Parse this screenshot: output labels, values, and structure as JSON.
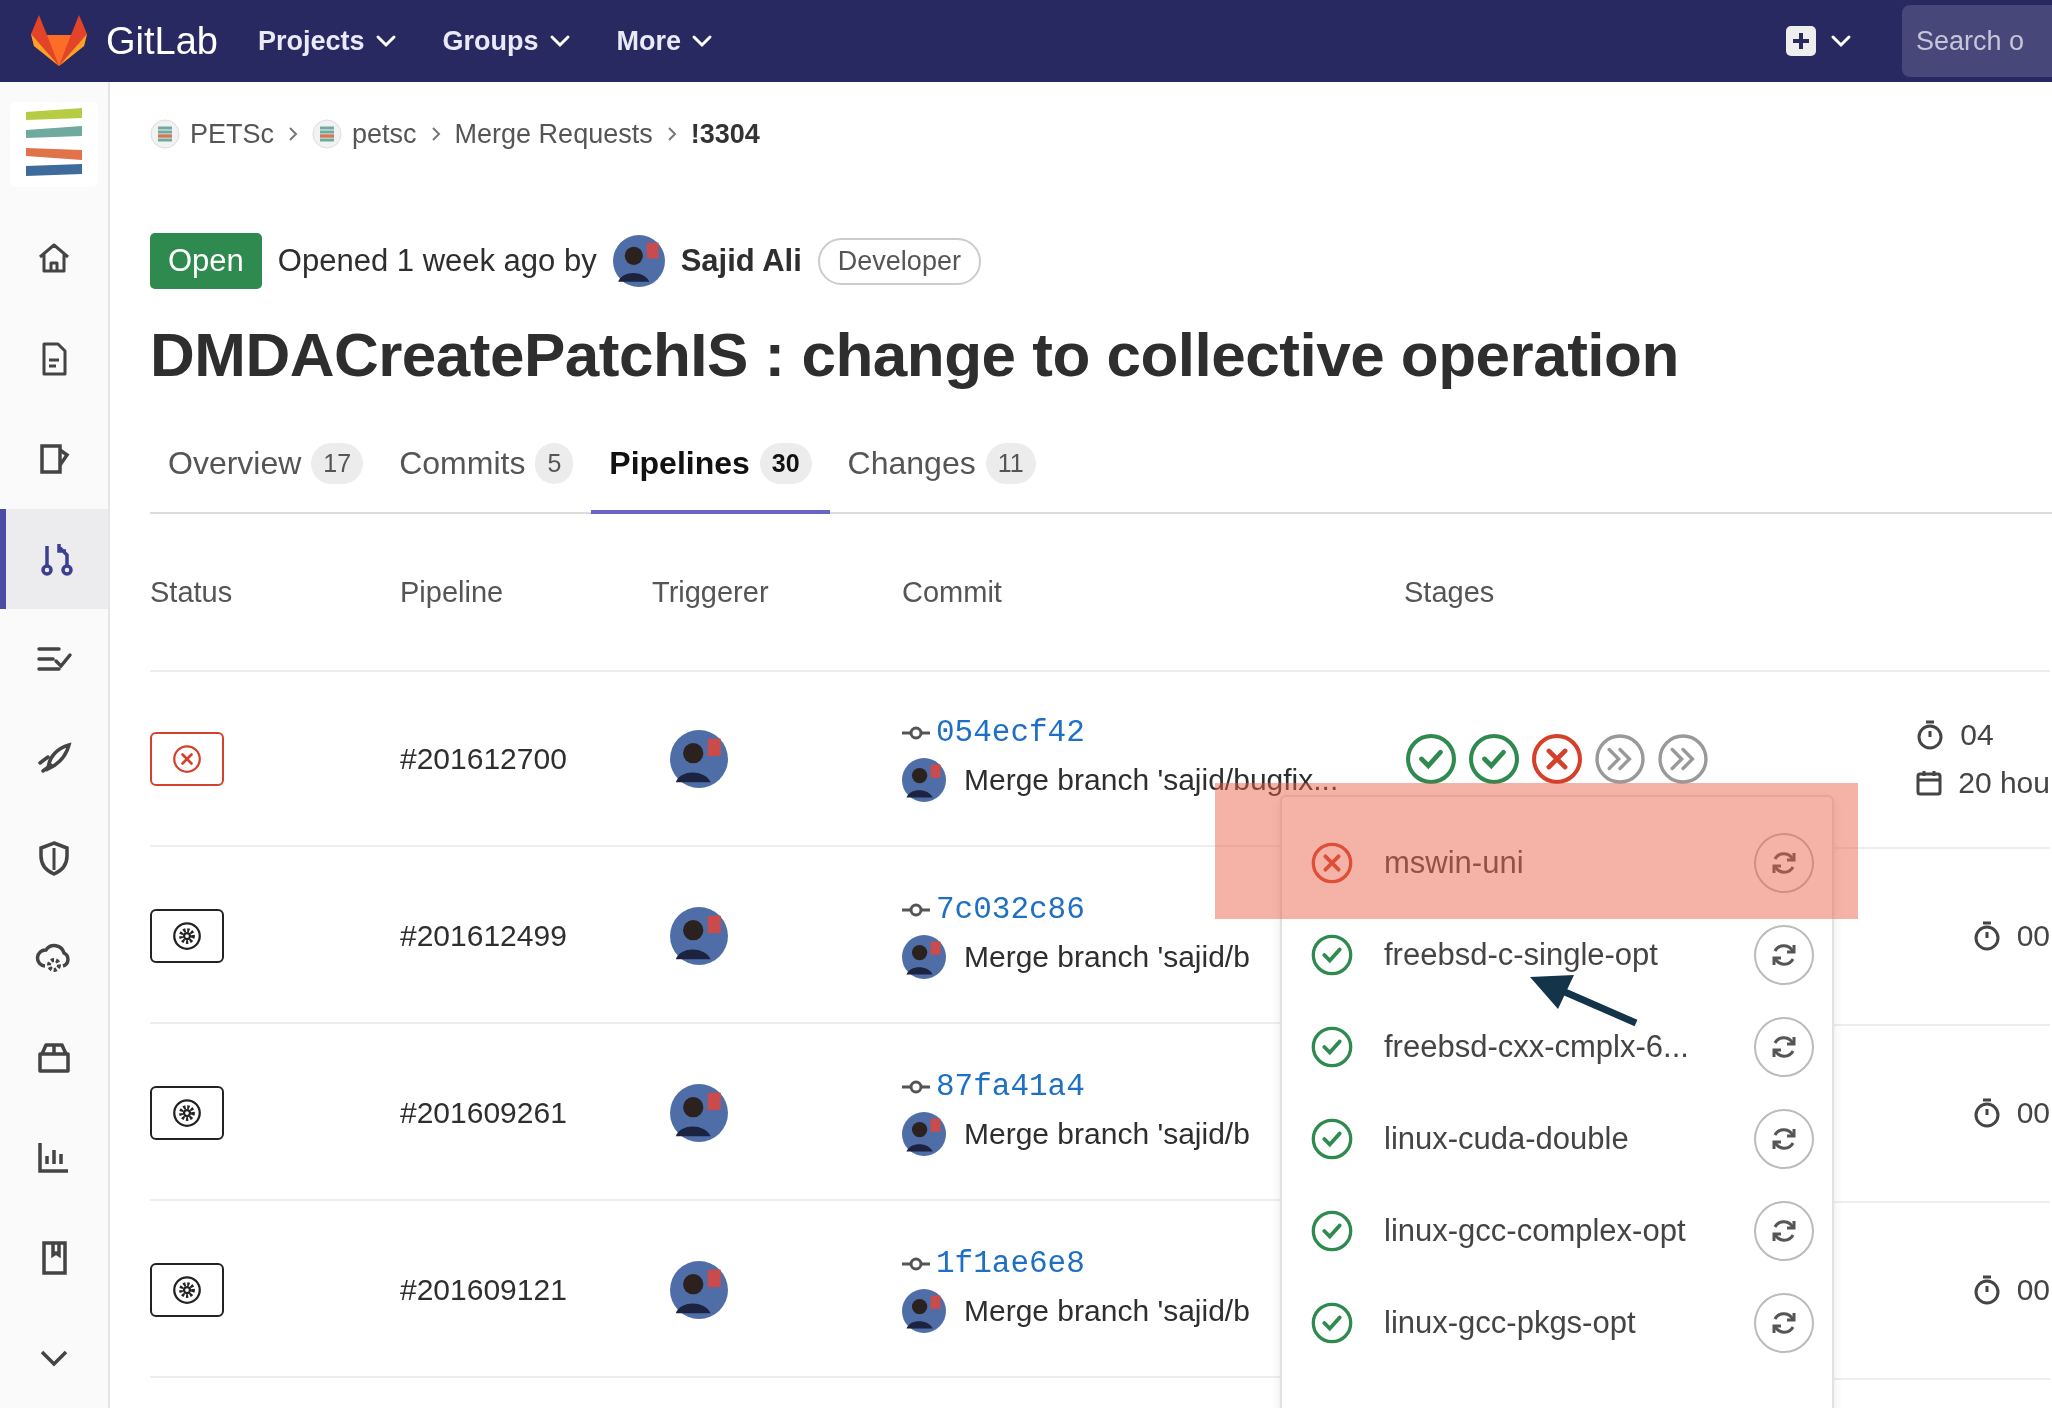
{
  "topbar": {
    "brand": "GitLab",
    "nav": [
      "Projects",
      "Groups",
      "More"
    ],
    "search": {
      "placeholder": "Search o"
    }
  },
  "sidebar": {
    "items": [
      {
        "kind": "home",
        "selected": false
      },
      {
        "kind": "doc",
        "selected": false
      },
      {
        "kind": "issue",
        "selected": false
      },
      {
        "kind": "merge",
        "selected": true
      },
      {
        "kind": "list",
        "selected": false
      },
      {
        "kind": "rocket",
        "selected": false
      },
      {
        "kind": "shield",
        "selected": false
      },
      {
        "kind": "cloud",
        "selected": false
      },
      {
        "kind": "package",
        "selected": false
      },
      {
        "kind": "chart",
        "selected": false
      },
      {
        "kind": "book",
        "selected": false
      },
      {
        "kind": "more",
        "selected": false
      }
    ]
  },
  "breadcrumb": [
    {
      "label": "PETSc",
      "avatar": true
    },
    {
      "label": "petsc",
      "avatar": true
    },
    {
      "label": "Merge Requests",
      "avatar": false
    },
    {
      "label": "!3304",
      "avatar": false
    }
  ],
  "header": {
    "status": "Open",
    "opened": "Opened 1 week ago by",
    "author": "Sajid Ali",
    "role": "Developer"
  },
  "title": "DMDACreatePatchIS : change to collective operation",
  "tabs": [
    {
      "label": "Overview",
      "count": "17",
      "selected": false
    },
    {
      "label": "Commits",
      "count": "5",
      "selected": false
    },
    {
      "label": "Pipelines",
      "count": "30",
      "selected": true
    },
    {
      "label": "Changes",
      "count": "11",
      "selected": false
    }
  ],
  "table": {
    "columns": [
      "Status",
      "Pipeline",
      "Triggerer",
      "Commit",
      "Stages"
    ],
    "rows": [
      {
        "kind": "failed",
        "pipeline": "#201612700",
        "sha": "054ecf42",
        "message": "Merge branch 'sajid/bugfix...",
        "stages": [
          {
            "kind": "success"
          },
          {
            "kind": "success"
          },
          {
            "kind": "failed"
          },
          {
            "kind": "skipped"
          },
          {
            "kind": "skipped"
          }
        ],
        "duration": "04",
        "finished": "20 hou"
      },
      {
        "kind": "manual",
        "pipeline": "#201612499",
        "sha": "7c032c86",
        "message": "Merge branch 'sajid/b",
        "duration": "00"
      },
      {
        "kind": "manual",
        "pipeline": "#201609261",
        "sha": "87fa41a4",
        "message": "Merge branch 'sajid/b",
        "duration": "00"
      },
      {
        "kind": "manual",
        "pipeline": "#201609121",
        "sha": "1f1ae6e8",
        "message": "Merge branch 'sajid/b",
        "duration": "00"
      }
    ]
  },
  "dropdown": {
    "jobs": [
      {
        "name": "mswin-uni",
        "kind": "failed"
      },
      {
        "name": "freebsd-c-single-opt",
        "kind": "success"
      },
      {
        "name": "freebsd-cxx-cmplx-6...",
        "kind": "success"
      },
      {
        "name": "linux-cuda-double",
        "kind": "success"
      },
      {
        "name": "linux-gcc-complex-opt",
        "kind": "success"
      },
      {
        "name": "linux-gcc-pkgs-opt",
        "kind": "success"
      }
    ]
  }
}
